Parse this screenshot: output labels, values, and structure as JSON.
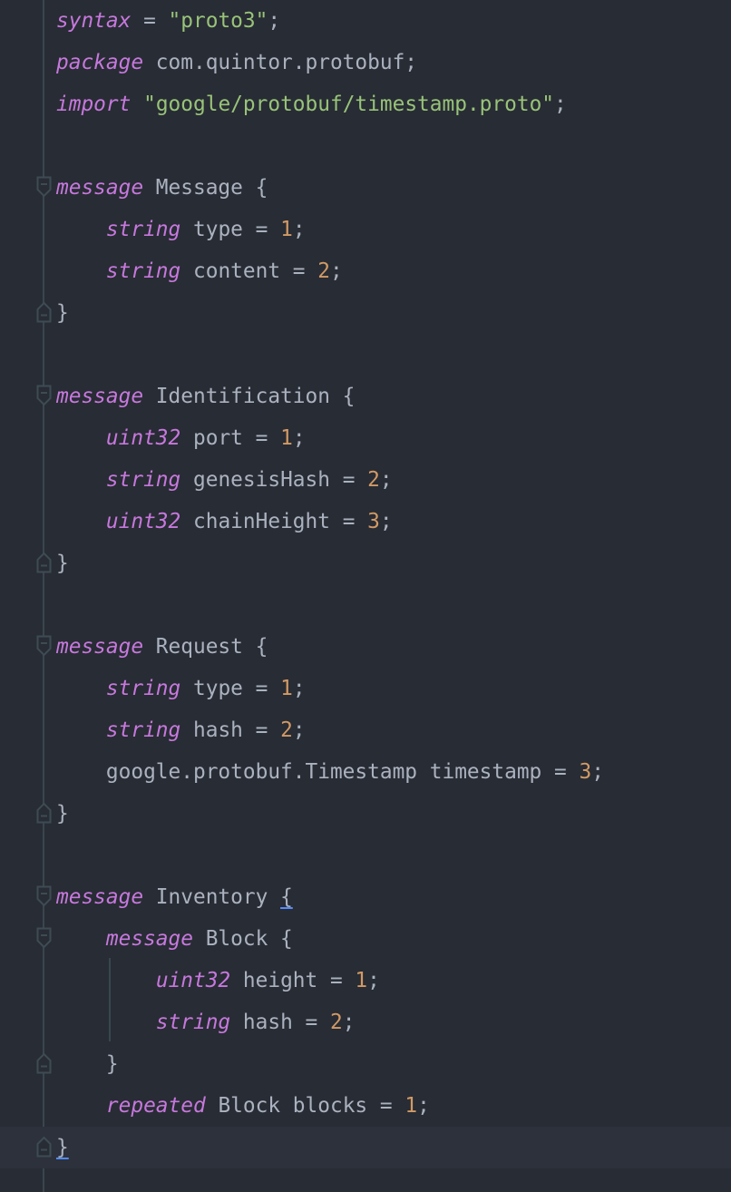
{
  "editor": {
    "language": "protobuf",
    "current_line": 27,
    "colors": {
      "background": "#282c34",
      "keyword": "#c678dd",
      "string": "#98c379",
      "number": "#d19a66",
      "text": "#abb2bf"
    },
    "lines": [
      [
        [
          "kw",
          "syntax"
        ],
        [
          "t",
          " = "
        ],
        [
          "str",
          "\"proto3\""
        ],
        [
          "t",
          ";"
        ]
      ],
      [
        [
          "kw",
          "package"
        ],
        [
          "t",
          " com.quintor.protobuf;"
        ]
      ],
      [
        [
          "kw",
          "import"
        ],
        [
          "t",
          " "
        ],
        [
          "str",
          "\"google/protobuf/timestamp.proto\""
        ],
        [
          "t",
          ";"
        ]
      ],
      [],
      [
        [
          "kw",
          "message"
        ],
        [
          "t",
          " Message {"
        ]
      ],
      [
        [
          "t",
          "    "
        ],
        [
          "kw",
          "string"
        ],
        [
          "t",
          " type = "
        ],
        [
          "num",
          "1"
        ],
        [
          "t",
          ";"
        ]
      ],
      [
        [
          "t",
          "    "
        ],
        [
          "kw",
          "string"
        ],
        [
          "t",
          " content = "
        ],
        [
          "num",
          "2"
        ],
        [
          "t",
          ";"
        ]
      ],
      [
        [
          "t",
          "}"
        ]
      ],
      [],
      [
        [
          "kw",
          "message"
        ],
        [
          "t",
          " Identification {"
        ]
      ],
      [
        [
          "t",
          "    "
        ],
        [
          "kw",
          "uint32"
        ],
        [
          "t",
          " port = "
        ],
        [
          "num",
          "1"
        ],
        [
          "t",
          ";"
        ]
      ],
      [
        [
          "t",
          "    "
        ],
        [
          "kw",
          "string"
        ],
        [
          "t",
          " genesisHash = "
        ],
        [
          "num",
          "2"
        ],
        [
          "t",
          ";"
        ]
      ],
      [
        [
          "t",
          "    "
        ],
        [
          "kw",
          "uint32"
        ],
        [
          "t",
          " chainHeight = "
        ],
        [
          "num",
          "3"
        ],
        [
          "t",
          ";"
        ]
      ],
      [
        [
          "t",
          "}"
        ]
      ],
      [],
      [
        [
          "kw",
          "message"
        ],
        [
          "t",
          " Request {"
        ]
      ],
      [
        [
          "t",
          "    "
        ],
        [
          "kw",
          "string"
        ],
        [
          "t",
          " type = "
        ],
        [
          "num",
          "1"
        ],
        [
          "t",
          ";"
        ]
      ],
      [
        [
          "t",
          "    "
        ],
        [
          "kw",
          "string"
        ],
        [
          "t",
          " hash = "
        ],
        [
          "num",
          "2"
        ],
        [
          "t",
          ";"
        ]
      ],
      [
        [
          "t",
          "    google.protobuf.Timestamp timestamp = "
        ],
        [
          "num",
          "3"
        ],
        [
          "t",
          ";"
        ]
      ],
      [
        [
          "t",
          "}"
        ]
      ],
      [],
      [
        [
          "kw",
          "message"
        ],
        [
          "t",
          " Inventory "
        ],
        [
          "match",
          "{"
        ]
      ],
      [
        [
          "t",
          "    "
        ],
        [
          "kw",
          "message"
        ],
        [
          "t",
          " Block {"
        ]
      ],
      [
        [
          "t",
          "        "
        ],
        [
          "kw",
          "uint32"
        ],
        [
          "t",
          " height = "
        ],
        [
          "num",
          "1"
        ],
        [
          "t",
          ";"
        ]
      ],
      [
        [
          "t",
          "        "
        ],
        [
          "kw",
          "string"
        ],
        [
          "t",
          " hash = "
        ],
        [
          "num",
          "2"
        ],
        [
          "t",
          ";"
        ]
      ],
      [
        [
          "t",
          "    }"
        ]
      ],
      [
        [
          "t",
          "    "
        ],
        [
          "kw",
          "repeated"
        ],
        [
          "t",
          " Block blocks = "
        ],
        [
          "num",
          "1"
        ],
        [
          "t",
          ";"
        ]
      ],
      [
        [
          "match",
          "}"
        ]
      ]
    ],
    "fold_open_lines": [
      4,
      9,
      15,
      21,
      22
    ],
    "fold_close_lines": [
      7,
      13,
      19,
      25,
      27
    ]
  }
}
